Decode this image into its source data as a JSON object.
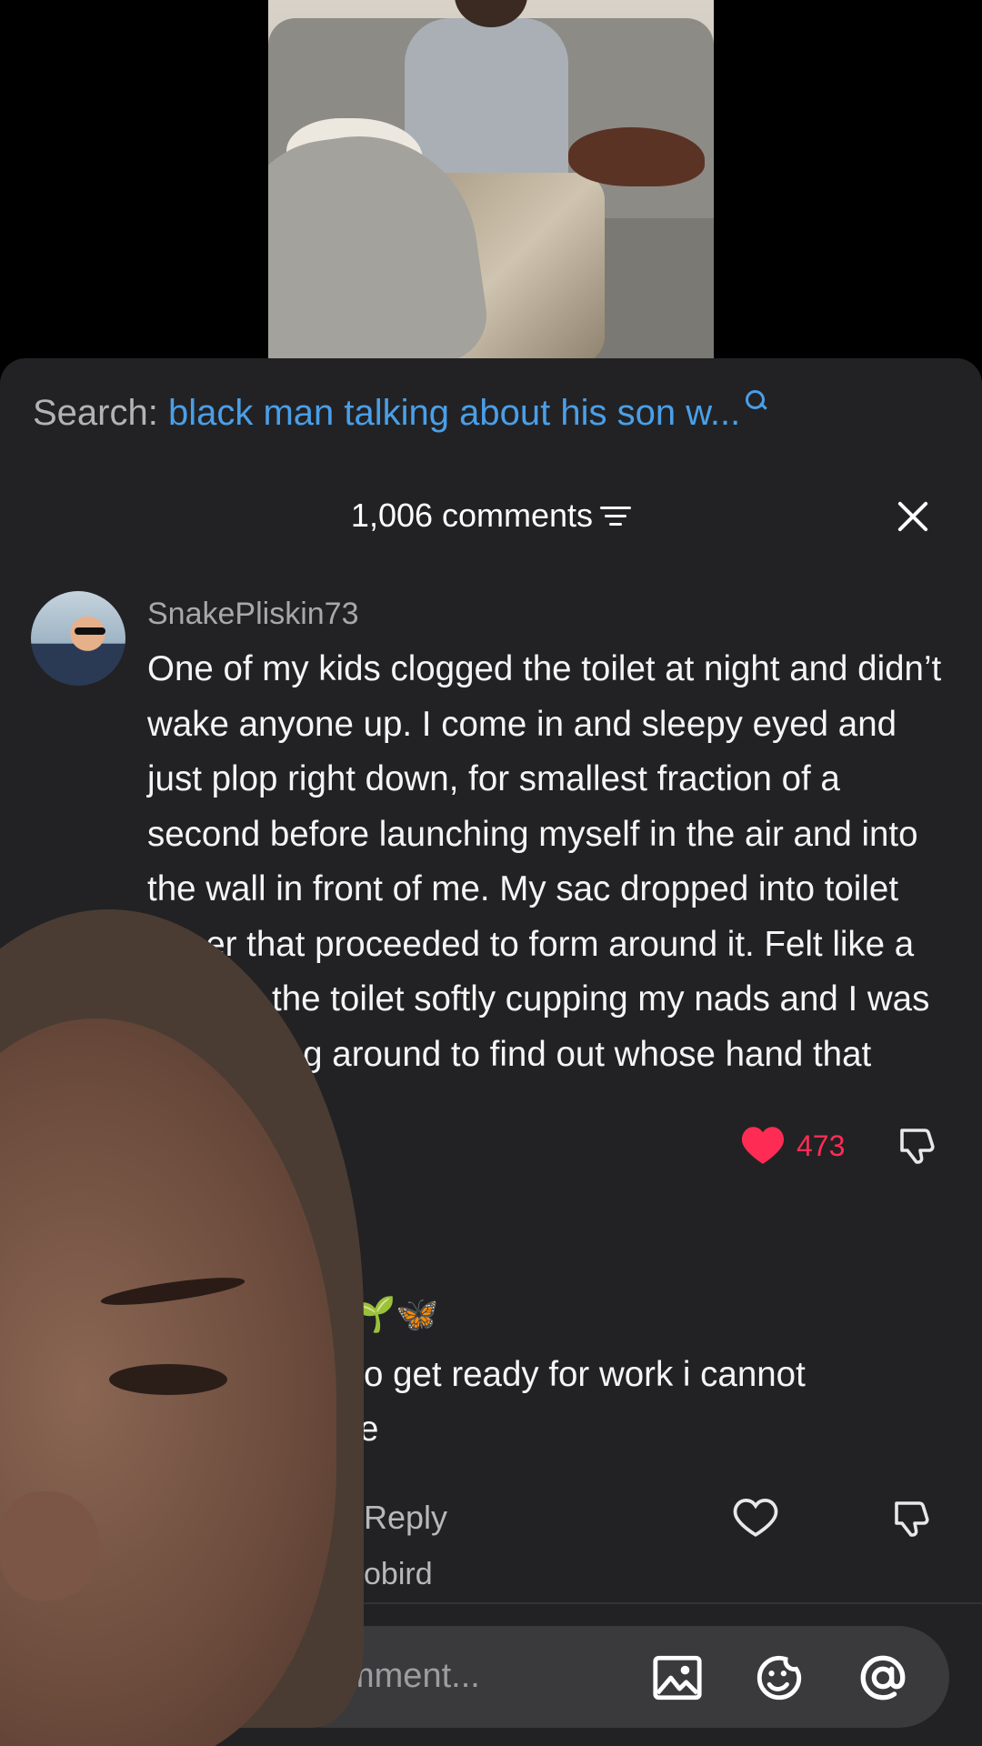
{
  "search": {
    "label": "Search:",
    "query": "black man talking about his son w..."
  },
  "comments_header": {
    "count_label": "1,006 comments"
  },
  "comments": [
    {
      "username": "SnakePliskin73",
      "text": "One of my kids clogged the toilet at night and didn’t wake anyone up. I come in and sleepy eyed and just plop right down, for smallest fraction of a second before launching myself in the air and into the wall in front of me. My sac dropped into toilet paper that proceeded to form around it. Felt like a hand in the toilet softly cupping my nads and I was not sticking around to find out whose hand that was.",
      "likes": "473",
      "liked": true
    },
    {
      "username_suffix": "🌱🦋",
      "text": "o get ready for work i cannot",
      "text_line2": "e",
      "reply_label": "Reply",
      "liked": false
    }
  ],
  "view_replies_partial": "obird",
  "input": {
    "placeholder": "mment..."
  },
  "icons": {
    "filter": "filter-lines-icon",
    "close": "close-icon",
    "like_filled": "heart-filled-icon",
    "like_outline": "heart-outline-icon",
    "dislike": "thumbs-down-icon",
    "image": "image-icon",
    "emoji": "emoji-icon",
    "mention": "at-sign-icon"
  },
  "colors": {
    "sheet_bg": "#222224",
    "search_query": "#4a9fe8",
    "like_active": "#fe2c55"
  }
}
